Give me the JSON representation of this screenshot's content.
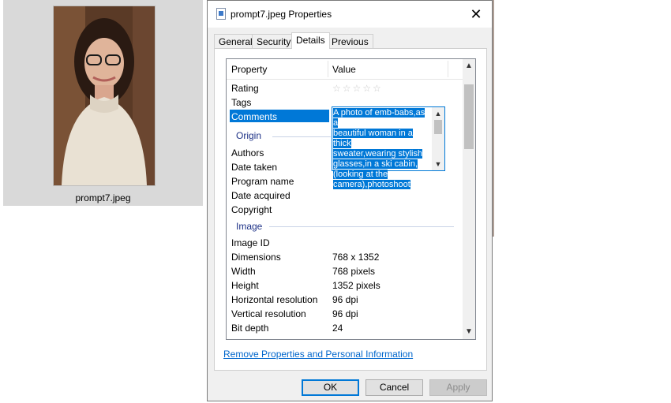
{
  "explorer": {
    "file_name": "prompt7.jpeg"
  },
  "dialog": {
    "title": "prompt7.jpeg Properties",
    "close_glyph": "✕",
    "tabs": [
      {
        "label": "General"
      },
      {
        "label": "Security"
      },
      {
        "label": "Details"
      },
      {
        "label": "Previous Versions"
      }
    ],
    "active_tab": "Details",
    "columns": {
      "property": "Property",
      "value": "Value"
    },
    "rating": {
      "label": "Rating",
      "stars_filled": 0,
      "stars_total": 5,
      "glyph": "☆☆☆☆☆"
    },
    "rows_description": [
      {
        "name": "Tags",
        "value": ""
      },
      {
        "name": "Comments",
        "value": "A photo of emb-babs,as a beautiful woman in a thick sweater,wearing stylish glasses,in a ski cabin, (looking at the camera),photoshoot"
      }
    ],
    "comment_lines": [
      "A photo of emb-babs,as a",
      "beautiful woman in a thick",
      "sweater,wearing stylish",
      "glasses,in a ski cabin,",
      "(looking at the",
      "camera),photoshoot"
    ],
    "groups": {
      "origin": "Origin",
      "image": "Image"
    },
    "origin_rows": [
      {
        "name": "Authors",
        "value": ""
      },
      {
        "name": "Date taken",
        "value": ""
      },
      {
        "name": "Program name",
        "value": ""
      },
      {
        "name": "Date acquired",
        "value": ""
      },
      {
        "name": "Copyright",
        "value": ""
      }
    ],
    "image_rows": [
      {
        "name": "Image ID",
        "value": ""
      },
      {
        "name": "Dimensions",
        "value": "768 x 1352"
      },
      {
        "name": "Width",
        "value": "768 pixels"
      },
      {
        "name": "Height",
        "value": "1352 pixels"
      },
      {
        "name": "Horizontal resolution",
        "value": "96 dpi"
      },
      {
        "name": "Vertical resolution",
        "value": "96 dpi"
      },
      {
        "name": "Bit depth",
        "value": "24"
      }
    ],
    "remove_link": "Remove Properties and Personal Information",
    "buttons": {
      "ok": "OK",
      "cancel": "Cancel",
      "apply": "Apply"
    },
    "scroll": {
      "up_glyph": "▲",
      "down_glyph": "▼"
    },
    "colors": {
      "accent": "#0078d7",
      "link": "#0066cc",
      "group_title": "#1e3287"
    }
  }
}
